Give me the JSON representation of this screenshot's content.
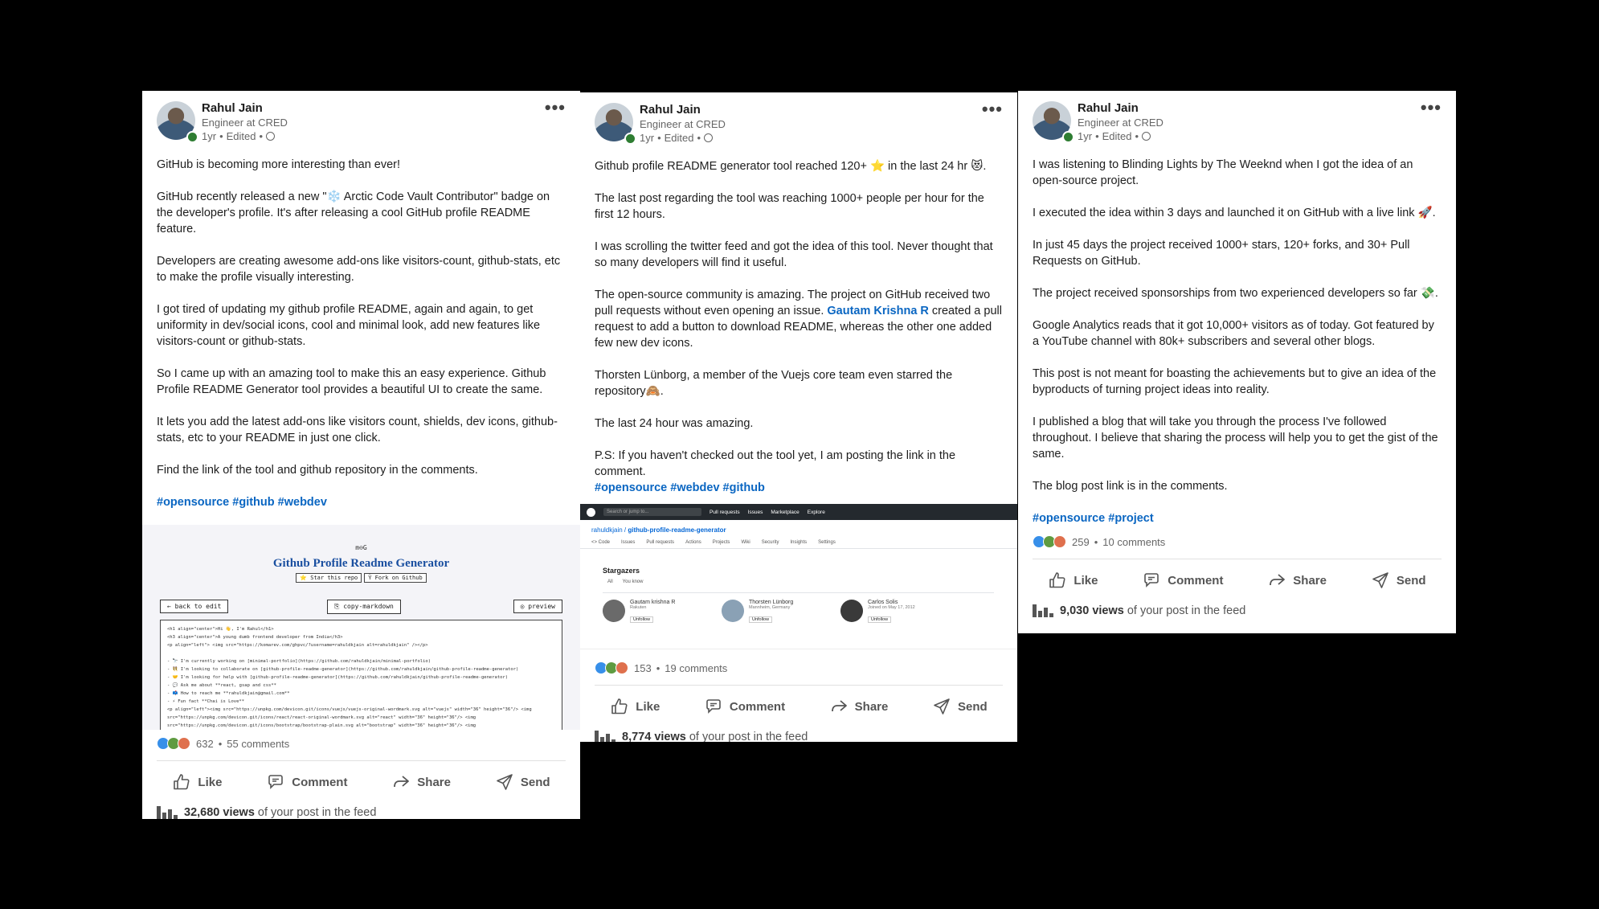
{
  "author": {
    "name": "Rahul Jain",
    "headline": "Engineer at CRED",
    "time": "1yr",
    "edited": "Edited"
  },
  "post1": {
    "paragraphs": [
      "GitHub is becoming more interesting than ever!",
      "GitHub recently released a new \"❄️ Arctic Code Vault Contributor\" badge on the developer's profile. It's after releasing a cool GitHub profile README feature.",
      "Developers are creating awesome add-ons like visitors-count, github-stats, etc to make the profile visually interesting.",
      "I got tired of updating my github profile README, again and again, to get uniformity in dev/social icons, cool and minimal look, add new features like visitors-count or github-stats.",
      "So I came up with an amazing tool to make this an easy experience. Github Profile README Generator tool provides a beautiful UI to create the same.",
      "It lets you add the latest add-ons like visitors count, shields, dev icons, github-stats, etc to your README in just one click.",
      "Find the link of the tool and github repository in the comments."
    ],
    "hashtags": "#opensource #github #webdev",
    "screenshot": {
      "logo": "m⊖G",
      "title": "Github Profile Readme Generator",
      "star_btn": "⭐ Star this repo",
      "fork_btn": "Ÿ Fork on Github",
      "back_btn": "← back to edit",
      "copy_btn": "⎘ copy-markdown",
      "preview_btn": "◎ preview",
      "code_lines": [
        "<h1 align=\"center\">Hi 👋, I'm Rahul</h1>",
        "<h3 align=\"center\">A young dumb frontend developer from India</h3>",
        "<p align=\"left\"> <img src=\"https://komarev.com/ghpvc/?username=rahuldkjain alt=rahuldkjain\" /></p>",
        "- 🔭 I'm currently working on [minimal-portfolio](https://github.com/rahuldkjain/minimal-portfolio)",
        "- 👯 I'm looking to collaborate on [github-profile-readme-generator](https://github.com/rahuldkjain/github-profile-readme-generator)",
        "- 🤝 I'm looking for help with [github-profile-readme-generator](https://github.com/rahuldkjain/github-profile-readme-generator)",
        "- 💬 Ask me about **react, gsap and css**",
        "- 📫 How to reach me **rahuldkjain@gmail.com**",
        "- ⚡ Fun fact **Chai is Love**",
        "<p align=\"left\"><img src=\"https://unpkg.com/devicon.git/icons/vuejs/vuejs-original-wordmark.svg alt=\"vuejs\" width=\"36\" height=\"36\"/> <img",
        "src=\"https://unpkg.com/devicon.git/icons/react/react-original-wordmark.svg alt=\"react\" width=\"36\" height=\"36\"/> <img",
        "src=\"https://unpkg.com/devicon.git/icons/bootstrap/bootstrap-plain.svg alt=\"bootstrap\" width=\"36\" height=\"36\"/> <img"
      ]
    },
    "reactions": "632",
    "comments": "55 comments",
    "views": "32,680 views",
    "views_suffix": "of your post in the feed"
  },
  "post2": {
    "paragraphs": [
      "Github profile README generator tool reached 120+ ⭐ in the last 24 hr 😻.",
      "The last post regarding the tool was reaching 1000+ people per hour for the first 12 hours.",
      "I was scrolling the twitter feed and got the idea of this tool. Never thought that so many developers will find it useful."
    ],
    "p4_before": "The open-source community is amazing. The project on GitHub received two pull requests without even opening an issue. ",
    "p4_mention": "Gautam Krishna R",
    "p4_after": " created a pull request to add a button to download README, whereas the other one added few new dev icons.",
    "p5": "Thorsten Lünborg, a member of the Vuejs core team even starred the repository🙈.",
    "p6": "The last 24 hour was amazing.",
    "p7": "P.S: If you haven't checked out the tool yet, I am posting the link in the comment.",
    "hashtags": "#opensource #webdev #github",
    "screenshot": {
      "search": "Search or jump to...",
      "nav": [
        "Pull requests",
        "Issues",
        "Marketplace",
        "Explore"
      ],
      "owner": "rahuldkjain",
      "repo": "github-profile-readme-generator",
      "tabs": [
        "<> Code",
        "Issues",
        "Pull requests",
        "Actions",
        "Projects",
        "Wiki",
        "Security",
        "Insights",
        "Settings"
      ],
      "heading": "Stargazers",
      "filters": [
        "All",
        "You know"
      ],
      "users": [
        {
          "name": "Gautam krishna R",
          "loc": "Rakuten",
          "btn": "Unfollow"
        },
        {
          "name": "Thorsten Lünborg",
          "loc": "Mannheim, Germany",
          "btn": "Unfollow"
        },
        {
          "name": "Carlos Solis",
          "loc": "Joined on May 17, 2012",
          "btn": "Unfollow"
        }
      ]
    },
    "reactions": "153",
    "comments": "19 comments",
    "views": "8,774 views",
    "views_suffix": "of your post in the feed"
  },
  "post3": {
    "paragraphs": [
      "I was listening to Blinding Lights by The Weeknd when I got the idea of an open-source project.",
      "I executed the idea within 3 days and launched it on GitHub with a live link 🚀.",
      "In just 45 days the project received 1000+ stars, 120+ forks, and 30+ Pull Requests on GitHub.",
      "The project received sponsorships from two experienced developers so far 💸.",
      "Google Analytics reads that it got 10,000+ visitors as of today. Got featured by a YouTube channel with 80k+ subscribers and several other blogs.",
      "This post is not meant for boasting the achievements but to give an idea of the byproducts of turning project ideas into reality.",
      "I published a blog that will take you through the process I've followed throughout. I believe that sharing the process will help you to get the gist of the same.",
      "The blog post link is in the comments."
    ],
    "hashtags": "#opensource #project",
    "reactions": "259",
    "comments": "10 comments",
    "views": "9,030 views",
    "views_suffix": "of your post in the feed"
  },
  "actions": {
    "like": "Like",
    "comment": "Comment",
    "share": "Share",
    "send": "Send"
  },
  "more": "•••"
}
